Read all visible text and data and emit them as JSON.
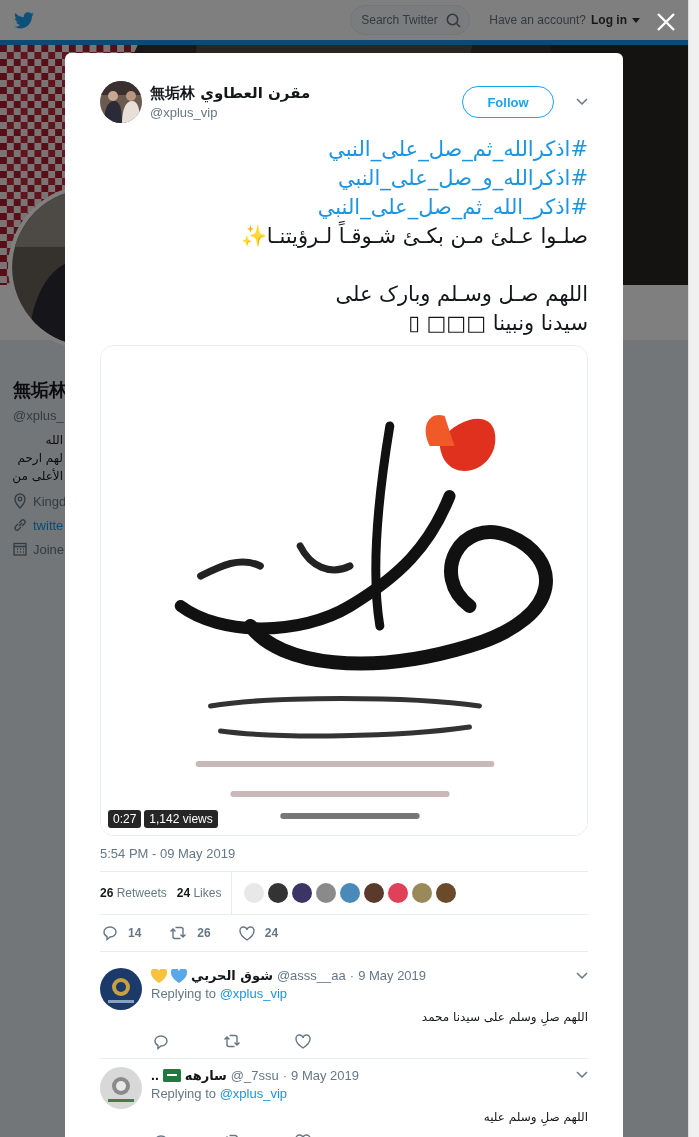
{
  "background_page": {
    "nav": {
      "search": {
        "placeholder": "Search Twitter"
      },
      "account_prompt": "Have an account?",
      "login": "Log in"
    },
    "profile": {
      "name": "無垢林",
      "handle": "@xplus_",
      "bio": [
        "الله",
        "لهم ارحم",
        "الأعلى من"
      ],
      "location": "Kingd",
      "link": "twitte",
      "joined": "Joine"
    }
  },
  "tweet": {
    "author": {
      "name": "無垢林 مقرن العطاوي",
      "handle": "@xplus_vip"
    },
    "follow": "Follow",
    "paragraphs": [
      [
        {
          "kind": "hashtag",
          "text": "#اذكرالله_ثم_صل_على_النبي"
        },
        {
          "kind": "hashtag",
          "text": "#اذكرالله_و_صل_على_النبي"
        },
        {
          "kind": "hashtag",
          "text": "#اذكر_الله_ثم_صل_على_النبي"
        },
        {
          "kind": "text",
          "text": "صلـوا عـلئ مـن بكـئ شـوقـاً لـرؤيتنـا✨"
        }
      ],
      [
        {
          "kind": "text",
          "text": "اللهم صـل وسـلم وبارک على"
        },
        {
          "kind": "text",
          "text": "سيدنا ونبينا □□□ ▯"
        }
      ]
    ],
    "media": {
      "kind": "picture",
      "duration": "0:27",
      "views": "1,142 views"
    },
    "timestamp": "5:54 PM - 09 May 2019",
    "retweets": {
      "count": "26",
      "label": "Retweets"
    },
    "likes": {
      "count": "24",
      "label": "Likes"
    },
    "likers": [
      {
        "color": "#e8e8e8"
      },
      {
        "color": "#333333"
      },
      {
        "color": "#3b3566"
      },
      {
        "color": "#8a8a8a"
      },
      {
        "color": "#4a8ab8"
      },
      {
        "color": "#5a3a2a"
      },
      {
        "color": "#e0405a"
      },
      {
        "color": "#9a8a5a"
      },
      {
        "color": "#6a4a2a"
      }
    ],
    "actions": {
      "replies": "14",
      "retweets": "26",
      "likes": "24"
    }
  },
  "replies": [
    {
      "name": "شوق الحربي",
      "emoji": [
        {
          "kind": "heart",
          "color": "#f7c23e"
        },
        {
          "kind": "heart",
          "color": "#5aa8e8"
        }
      ],
      "handle": "@asss__aa",
      "separator": "·",
      "date": "9 May 2019",
      "replying_label": "Replying to",
      "replying_to": "@xplus_vip",
      "text": "اللهم صلِ وسلم على سيدنا محمد"
    },
    {
      "name": "سارهه",
      "trail": "..",
      "emoji": [
        {
          "kind": "flag",
          "color": "#1e7a3e"
        }
      ],
      "handle": "@_7ssu",
      "separator": "·",
      "date": "9 May 2019",
      "replying_label": "Replying to",
      "replying_to": "@xplus_vip",
      "text": "اللهم صلِ وسلم عليه"
    }
  ]
}
